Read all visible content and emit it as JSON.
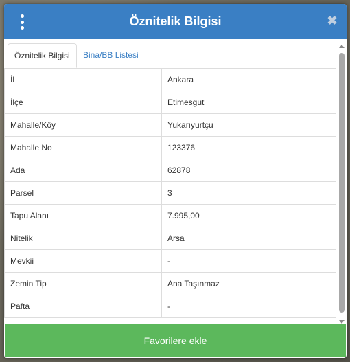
{
  "header": {
    "title": "Öznitelik Bilgisi",
    "close_glyph": "✖"
  },
  "tabs": [
    {
      "label": "Öznitelik Bilgisi"
    },
    {
      "label": "Bina/BB Listesi"
    }
  ],
  "rows": [
    {
      "key": "İl",
      "value": "Ankara"
    },
    {
      "key": "İlçe",
      "value": "Etimesgut"
    },
    {
      "key": "Mahalle/Köy",
      "value": "Yukarıyurtçu"
    },
    {
      "key": "Mahalle No",
      "value": "123376"
    },
    {
      "key": "Ada",
      "value": "62878"
    },
    {
      "key": "Parsel",
      "value": "3"
    },
    {
      "key": "Tapu Alanı",
      "value": "7.995,00"
    },
    {
      "key": "Nitelik",
      "value": "Arsa"
    },
    {
      "key": "Mevkii",
      "value": "-"
    },
    {
      "key": "Zemin Tip",
      "value": "Ana Taşınmaz"
    },
    {
      "key": "Pafta",
      "value": "-"
    }
  ],
  "footer": {
    "button_label": "Favorilere ekle"
  },
  "colors": {
    "header": "#3a7fc4",
    "button": "#5cb85c",
    "link": "#3a7fc4"
  }
}
